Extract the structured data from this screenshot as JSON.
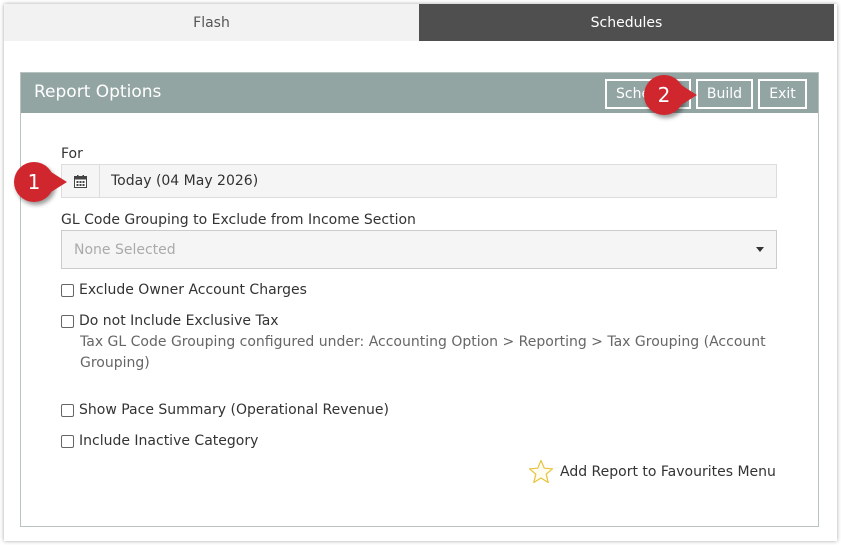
{
  "tabs": {
    "flash": "Flash",
    "schedules": "Schedules"
  },
  "panel": {
    "title": "Report Options",
    "buttons": {
      "schedule": "Schedule",
      "build": "Build",
      "exit": "Exit"
    }
  },
  "markers": {
    "one": "1",
    "two": "2"
  },
  "form": {
    "for_label": "For",
    "date_value": "Today (04 May 2026)",
    "gl_label": "GL Code Grouping to Exclude from Income Section",
    "gl_placeholder": "None Selected",
    "checks": {
      "exclude_owner": "Exclude Owner Account Charges",
      "exclusive_tax": "Do not Include Exclusive Tax",
      "exclusive_tax_help": "Tax GL Code Grouping configured under: Accounting Option > Reporting > Tax Grouping (Account Grouping)",
      "pace_summary": "Show Pace Summary (Operational Revenue)",
      "inactive_category": "Include Inactive Category"
    },
    "favourites": "Add Report to Favourites Menu"
  },
  "colors": {
    "header": "#93a5a2",
    "marker": "#d0262d",
    "active_tab": "#4f4f4f"
  },
  "icons": {
    "date": "calendar-icon",
    "favourite": "star-icon",
    "dropdown": "caret-down-icon"
  }
}
